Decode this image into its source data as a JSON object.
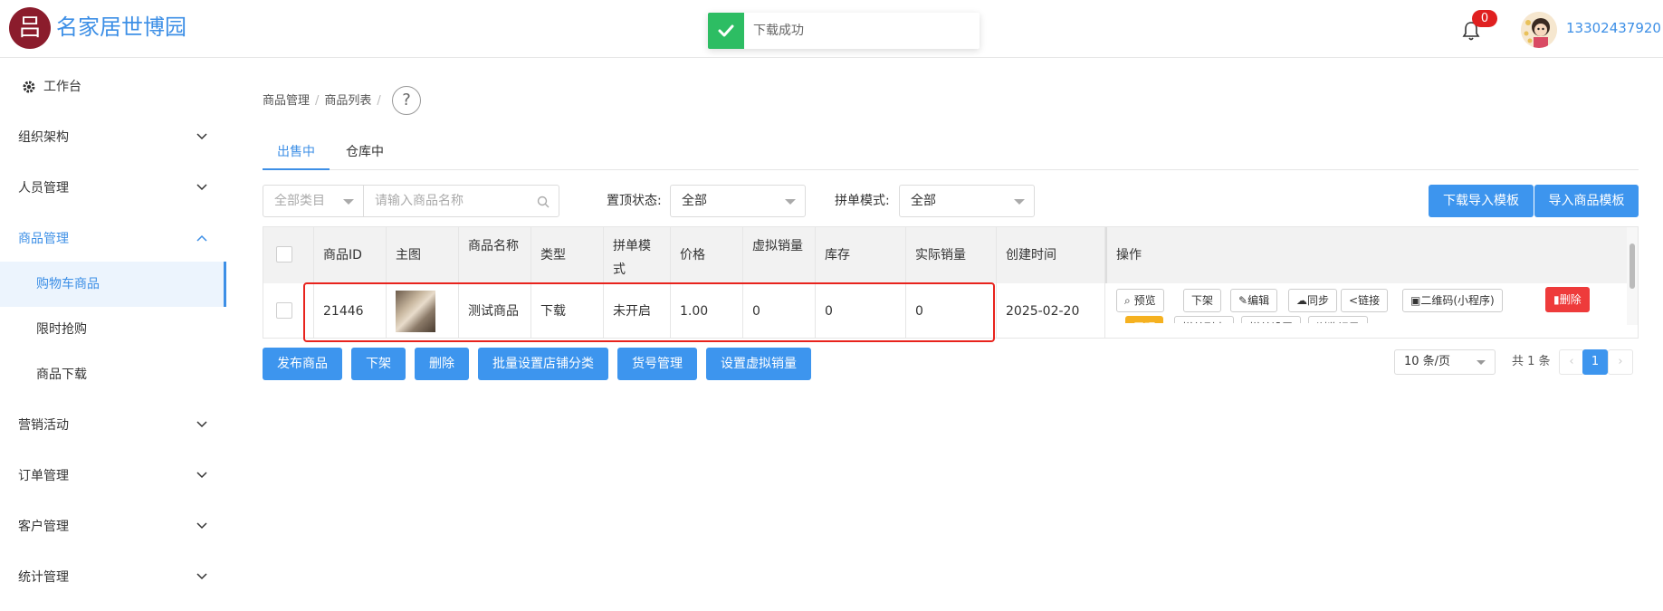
{
  "header": {
    "logo_glyph": "吕",
    "brand": "名家居世博园",
    "notification_count": "0",
    "username": "13302437920"
  },
  "toast": {
    "text": "下载成功"
  },
  "sidebar": {
    "workbench": "工作台",
    "items": [
      {
        "label": "组织架构"
      },
      {
        "label": "人员管理"
      },
      {
        "label": "商品管理"
      },
      {
        "label": "营销活动"
      },
      {
        "label": "订单管理"
      },
      {
        "label": "客户管理"
      },
      {
        "label": "统计管理"
      }
    ],
    "sub_items": [
      {
        "label": "购物车商品"
      },
      {
        "label": "限时抢购"
      },
      {
        "label": "商品下载"
      }
    ]
  },
  "breadcrumb": {
    "level1": "商品管理",
    "level2": "商品列表",
    "sep": "/",
    "help": "?"
  },
  "tabs": [
    {
      "label": "出售中"
    },
    {
      "label": "仓库中"
    }
  ],
  "filters": {
    "category": "全部类目",
    "name_placeholder": "请输入商品名称",
    "top_label": "置顶状态:",
    "top_value": "全部",
    "group_label": "拼单模式:",
    "group_value": "全部"
  },
  "top_buttons": {
    "download_template": "下载导入模板",
    "import_template": "导入商品模板"
  },
  "table": {
    "headers": {
      "id": "商品ID",
      "image": "主图",
      "name": "商品名称",
      "type": "类型",
      "group_mode": "拼单模式",
      "price": "价格",
      "virtual_sales": "虚拟销量",
      "stock": "库存",
      "actual_sales": "实际销量",
      "created": "创建时间",
      "ops": "操作"
    },
    "row": {
      "id": "21446",
      "name": "测试商品",
      "type": "下载",
      "group_mode": "未开启",
      "price": "1.00",
      "virtual_sales": "0",
      "stock": "0",
      "actual_sales": "0",
      "created": "2025-02-20"
    },
    "ops": {
      "preview": "预览",
      "offline": "下架",
      "edit": "编辑",
      "sync": "同步",
      "link": "链接",
      "qrcode": "二维码(小程序)",
      "delete": "删除",
      "pin": "置顶",
      "group_list": "拼单列表",
      "group_settings": "拼单设置",
      "browse_log": "浏览记录"
    }
  },
  "bottom_buttons": {
    "publish": "发布商品",
    "offline": "下架",
    "delete": "删除",
    "batch_category": "批量设置店铺分类",
    "sku": "货号管理",
    "virtual_sales": "设置虚拟销量"
  },
  "pagination": {
    "per_page": "10 条/页",
    "total": "共 1 条",
    "current": "1",
    "prev": "‹",
    "next": "›"
  },
  "colors": {
    "accent": "#3d95ee",
    "brand": "#8b1c2c",
    "danger": "#e8231d",
    "success": "#2dbd63"
  }
}
